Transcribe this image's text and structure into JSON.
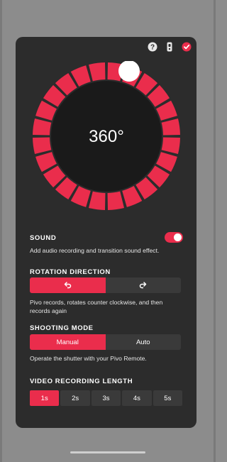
{
  "colors": {
    "accent": "#ea2d4c",
    "panel": "#2c2c2c",
    "segment_off": "#3a3a3a"
  },
  "top_icons": [
    "help-icon",
    "remote-icon",
    "checkmark-icon"
  ],
  "dial": {
    "angle_text": "360°",
    "segments": 24
  },
  "sound": {
    "label": "SOUND",
    "description": "Add audio recording and transition sound effect.",
    "enabled": true
  },
  "rotation": {
    "label": "ROTATION DIRECTION",
    "options": [
      "counterclockwise-icon",
      "clockwise-icon"
    ],
    "selected_index": 0,
    "description": "Pivo  records, rotates counter clockwise, and then records again"
  },
  "shooting_mode": {
    "label": "SHOOTING MODE",
    "options": [
      "Manual",
      "Auto"
    ],
    "selected_index": 0,
    "description": "Operate the shutter with your Pivo Remote."
  },
  "video_length": {
    "label": "VIDEO RECORDING LENGTH",
    "options": [
      "1s",
      "2s",
      "3s",
      "4s",
      "5s"
    ],
    "selected_index": 0
  }
}
